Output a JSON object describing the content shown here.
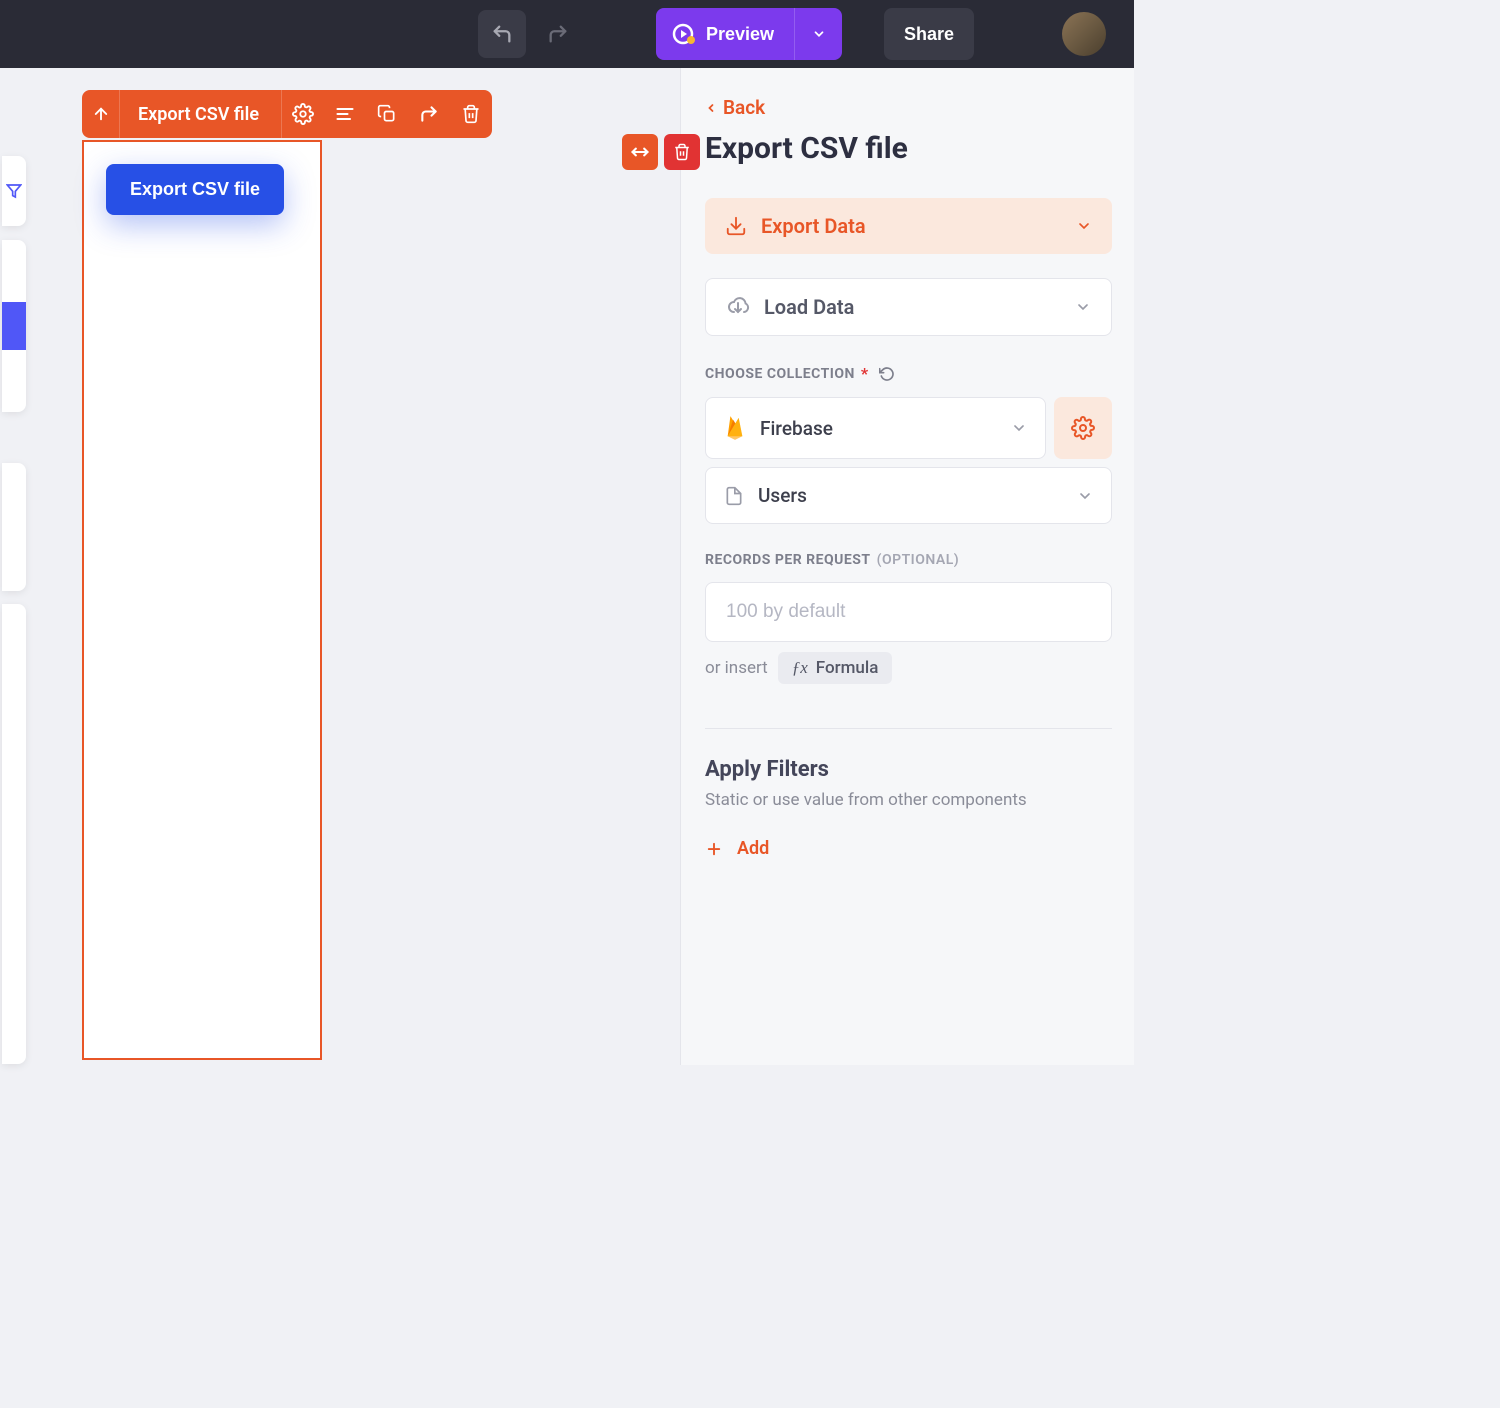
{
  "topbar": {
    "preview": "Preview",
    "share": "Share"
  },
  "canvas": {
    "selected_name": "Export CSV file",
    "export_button": "Export CSV file"
  },
  "panel": {
    "back": "Back",
    "title": "Export CSV file",
    "export_data": "Export Data",
    "load_data": "Load Data",
    "choose_collection_label": "CHOOSE COLLECTION",
    "firebase": "Firebase",
    "users": "Users",
    "records_label": "RECORDS PER REQUEST",
    "records_optional": "(OPTIONAL)",
    "records_placeholder": "100 by default",
    "or_insert": "or insert",
    "formula": "Formula",
    "apply_filters": "Apply Filters",
    "filters_sub": "Static or use value from other components",
    "add": "Add"
  }
}
